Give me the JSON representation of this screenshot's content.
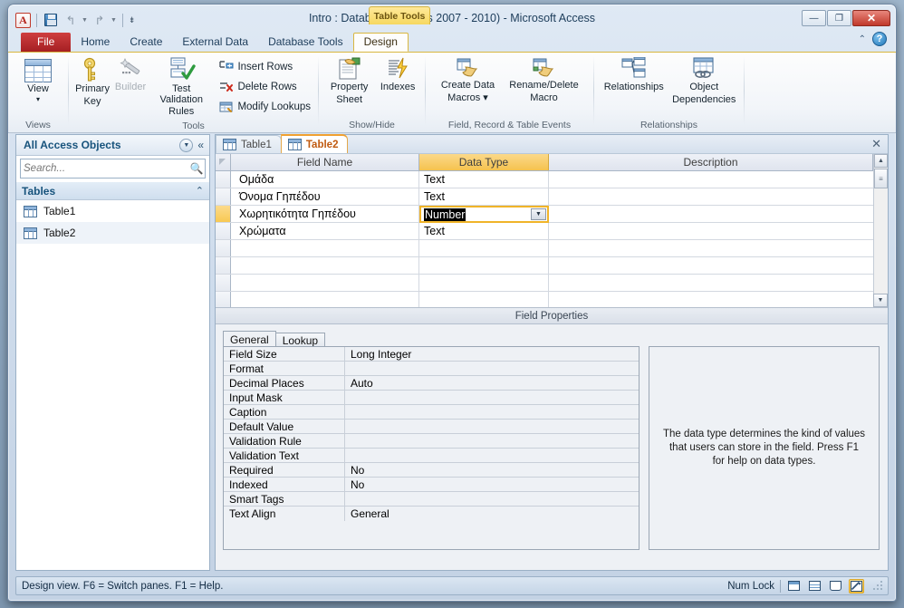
{
  "window": {
    "title": "Intro : Database (Access 2007 - 2010)  -  Microsoft Access",
    "contextual_tab": "Table Tools",
    "minimize": "—",
    "restore": "❐",
    "close": "✕"
  },
  "quick_access": {
    "logo": "A",
    "save_icon": "save-icon",
    "undo_icon": "undo-icon",
    "redo_icon": "redo-icon",
    "customize_icon": "customize-toolbar-icon"
  },
  "ribbon": {
    "tabs": [
      {
        "label": "File",
        "kind": "file"
      },
      {
        "label": "Home",
        "kind": "normal"
      },
      {
        "label": "Create",
        "kind": "normal"
      },
      {
        "label": "External Data",
        "kind": "normal"
      },
      {
        "label": "Database Tools",
        "kind": "normal"
      },
      {
        "label": "Design",
        "kind": "active-ctx"
      }
    ],
    "help_collapse_icon": "chevron-up-icon",
    "help_icon": "?",
    "groups": [
      {
        "name": "Views",
        "buttons": [
          {
            "label": "View",
            "dropdown": "▾"
          }
        ]
      },
      {
        "name": "Tools",
        "buttons": [
          {
            "label": "Primary\nKey",
            "line1": "Primary",
            "line2": "Key"
          },
          {
            "label": "Builder",
            "disabled": true
          },
          {
            "label": "Test Validation\nRules",
            "line1": "Test Validation",
            "line2": "Rules"
          }
        ],
        "small_buttons": [
          {
            "label": "Insert Rows"
          },
          {
            "label": "Delete Rows"
          },
          {
            "label": "Modify Lookups"
          }
        ]
      },
      {
        "name": "Show/Hide",
        "buttons": [
          {
            "line1": "Property",
            "line2": "Sheet"
          },
          {
            "line1": "Indexes",
            "line2": ""
          }
        ]
      },
      {
        "name": "Field, Record & Table Events",
        "buttons": [
          {
            "line1": "Create Data",
            "line2": "Macros ▾"
          },
          {
            "line1": "Rename/Delete",
            "line2": "Macro"
          }
        ]
      },
      {
        "name": "Relationships",
        "buttons": [
          {
            "line1": "Relationships",
            "line2": ""
          },
          {
            "line1": "Object",
            "line2": "Dependencies"
          }
        ]
      }
    ]
  },
  "nav_pane": {
    "title": "All Access Objects",
    "dropdown_icon": "chevron-down-icon",
    "collapse_icon": "double-chevron-left-icon",
    "search": {
      "value": "",
      "placeholder": "Search..."
    },
    "search_icon": "search-icon",
    "group": {
      "label": "Tables",
      "chevron": "⌃"
    },
    "items": [
      {
        "label": "Table1",
        "selected": false
      },
      {
        "label": "Table2",
        "selected": true
      }
    ]
  },
  "document": {
    "tabs": [
      {
        "label": "Table1",
        "active": false
      },
      {
        "label": "Table2",
        "active": true
      }
    ],
    "close_icon": "✕"
  },
  "grid": {
    "headers": [
      "Field Name",
      "Data Type",
      "Description"
    ],
    "selected_header": "Data Type",
    "rows": [
      {
        "field_name": "Ομάδα",
        "data_type": "Text",
        "description": "",
        "current": false
      },
      {
        "field_name": "Όνομα Γηπέδου",
        "data_type": "Text",
        "description": "",
        "current": false
      },
      {
        "field_name": "Χωρητικότητα Γηπέδου",
        "data_type": "Number",
        "description": "",
        "current": true
      },
      {
        "field_name": "Χρώματα",
        "data_type": "Text",
        "description": "",
        "current": false
      }
    ],
    "empty_rows": 5,
    "scroll_up_icon": "▲",
    "scroll_down_icon": "▼"
  },
  "field_properties": {
    "bar_title": "Field Properties",
    "tabs": [
      {
        "label": "General",
        "active": true
      },
      {
        "label": "Lookup",
        "active": false
      }
    ],
    "rows": [
      {
        "name": "Field Size",
        "value": "Long Integer"
      },
      {
        "name": "Format",
        "value": ""
      },
      {
        "name": "Decimal Places",
        "value": "Auto"
      },
      {
        "name": "Input Mask",
        "value": ""
      },
      {
        "name": "Caption",
        "value": ""
      },
      {
        "name": "Default Value",
        "value": ""
      },
      {
        "name": "Validation Rule",
        "value": ""
      },
      {
        "name": "Validation Text",
        "value": ""
      },
      {
        "name": "Required",
        "value": "No"
      },
      {
        "name": "Indexed",
        "value": "No"
      },
      {
        "name": "Smart Tags",
        "value": ""
      },
      {
        "name": "Text Align",
        "value": "General"
      }
    ],
    "help_text": "The data type determines the kind of values that users can store in the field. Press F1 for help on data types."
  },
  "status_bar": {
    "text": "Design view.  F6 = Switch panes.  F1 = Help.",
    "num_lock": "Num Lock",
    "view_buttons": [
      {
        "name": "datasheet-view-button",
        "active": false
      },
      {
        "name": "pivottable-view-button",
        "active": false
      },
      {
        "name": "pivotchart-view-button",
        "active": false
      },
      {
        "name": "design-view-button",
        "active": true
      }
    ]
  },
  "colors": {
    "accent_orange": "#f0a030",
    "file_tab_red": "#a51f23",
    "contextual_yellow": "#f6d860",
    "selection_black": "#000000",
    "nav_title_blue": "#17537c"
  }
}
